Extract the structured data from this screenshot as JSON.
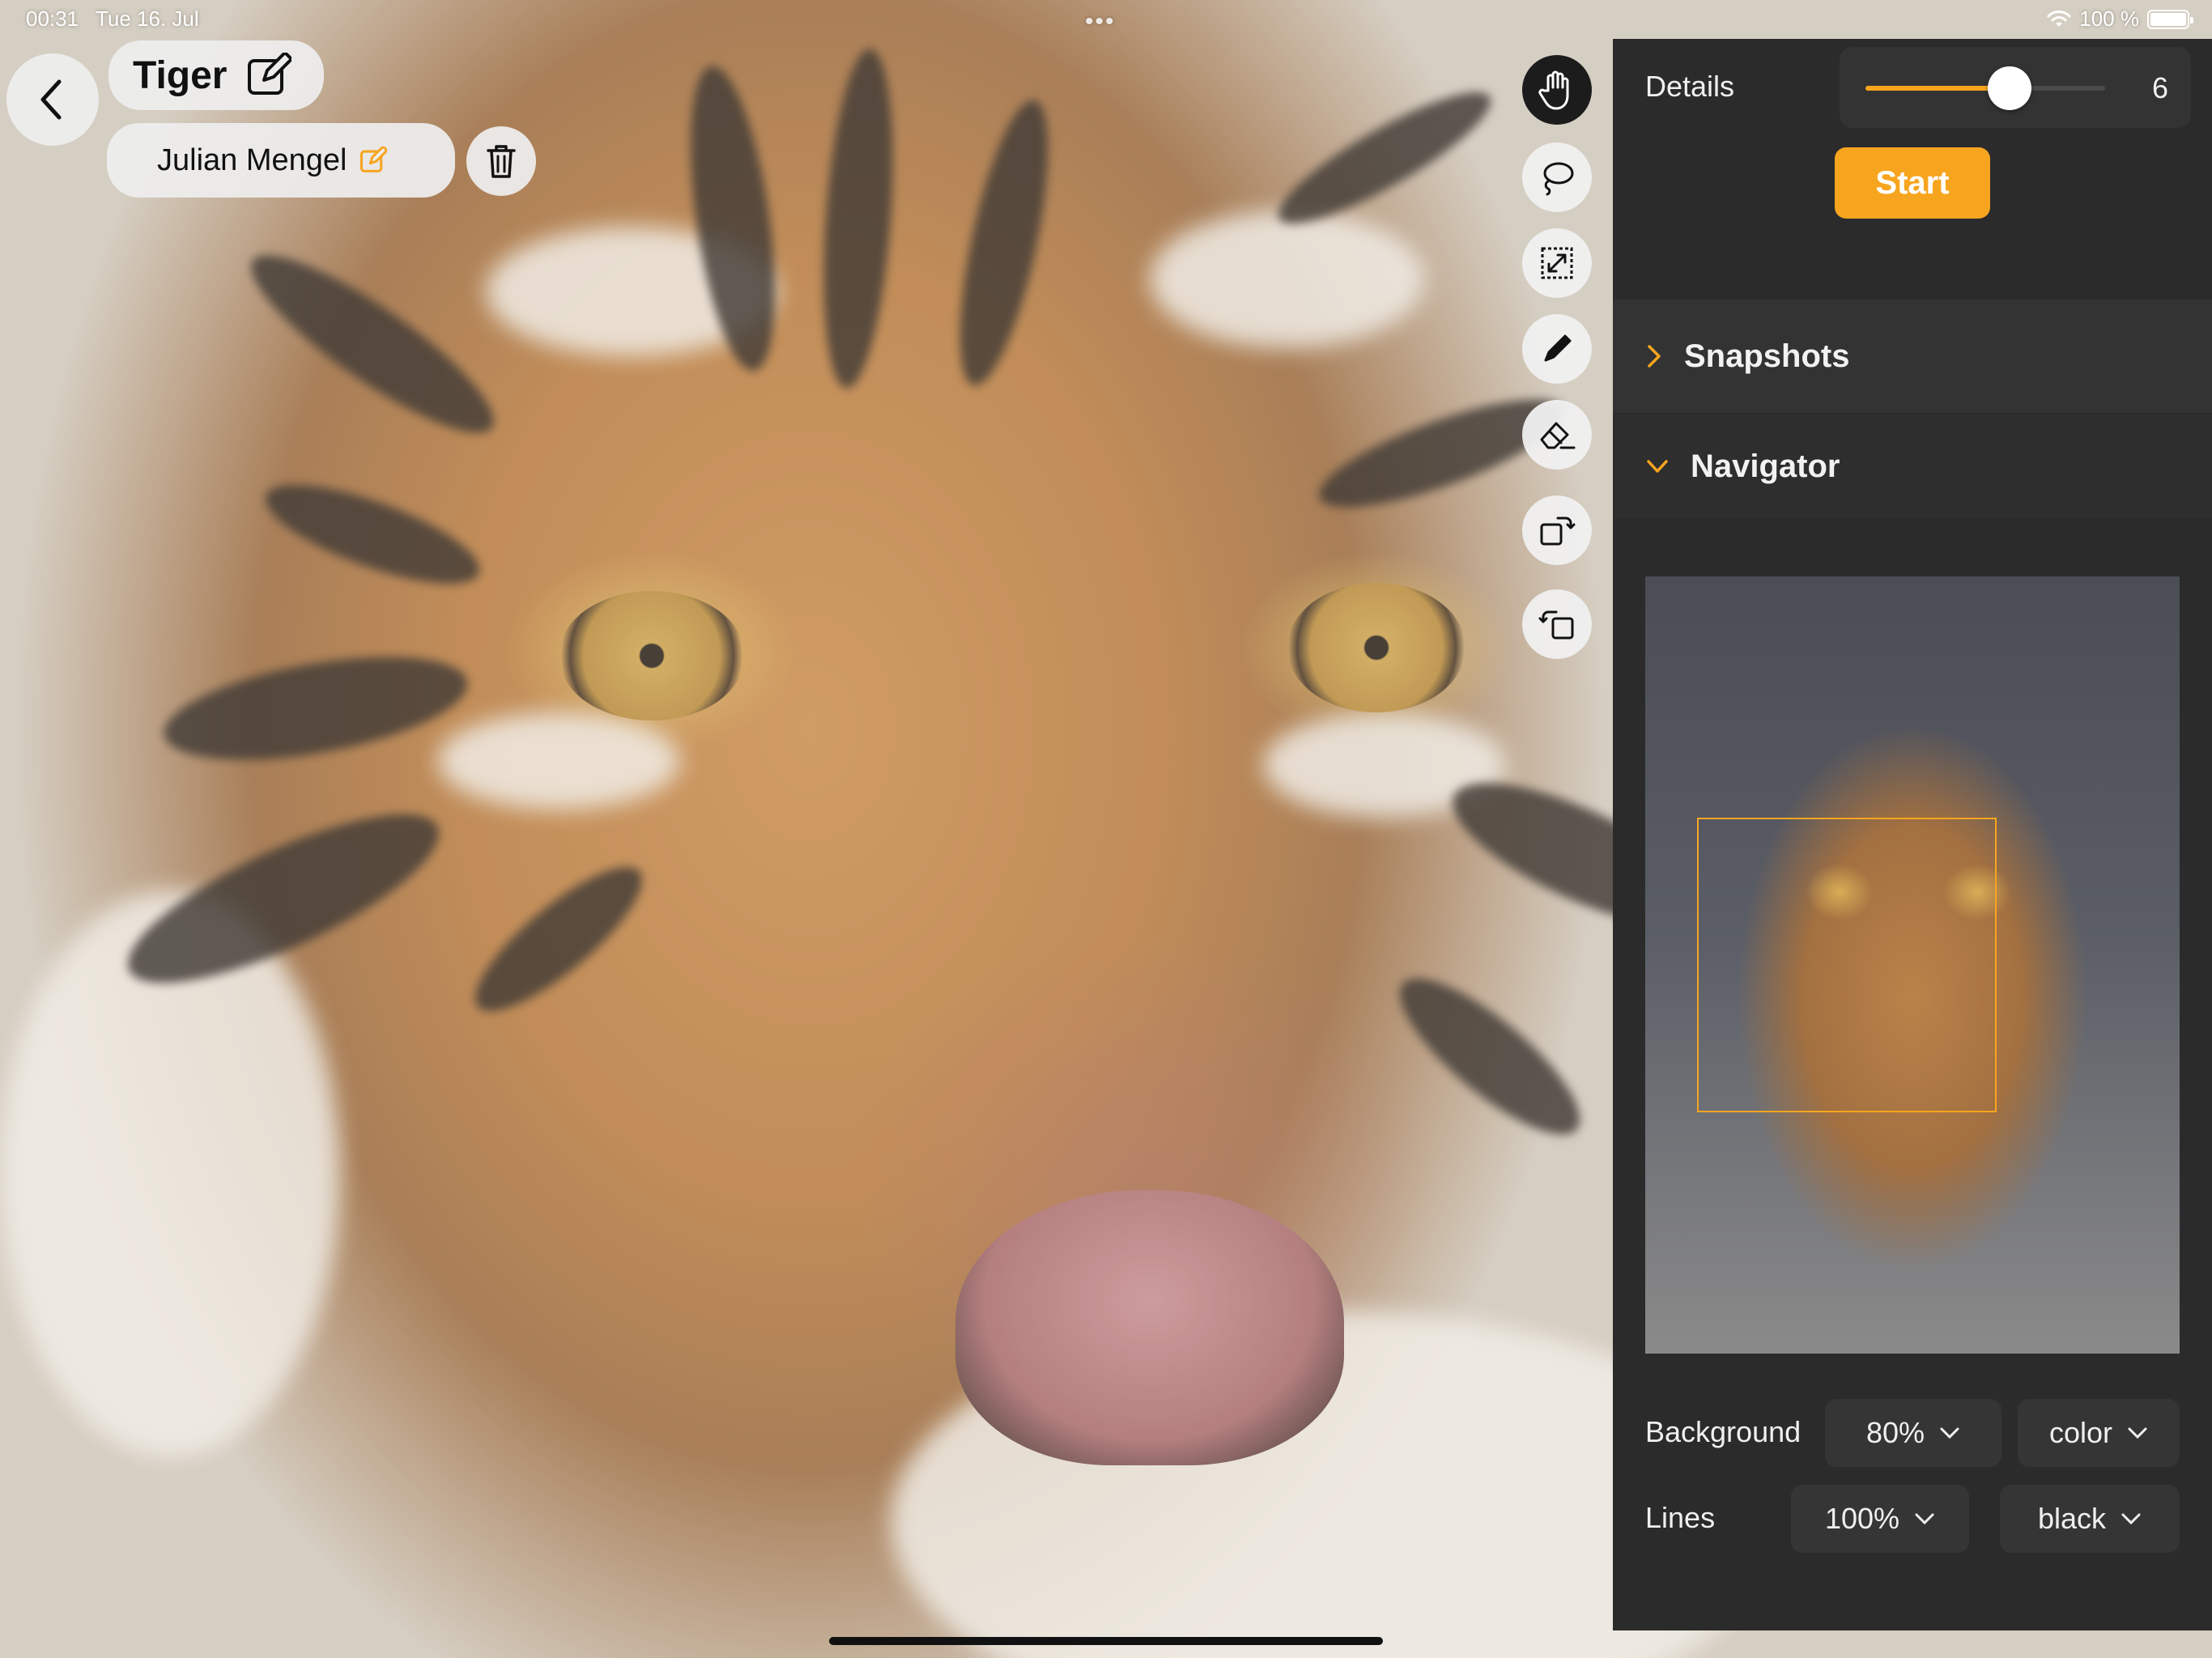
{
  "status_bar": {
    "time": "00:31",
    "date": "Tue 16. Jul",
    "battery": "100 %",
    "multitask_dots": "•••"
  },
  "drawing": {
    "title": "Tiger",
    "author": "Julian Mengel"
  },
  "toolbar": {
    "tools": [
      {
        "name": "hand",
        "active": true
      },
      {
        "name": "lasso",
        "active": false
      },
      {
        "name": "resize",
        "active": false
      },
      {
        "name": "pencil",
        "active": false
      },
      {
        "name": "eraser",
        "active": false
      },
      {
        "name": "rotate-right",
        "active": false
      },
      {
        "name": "rotate-left",
        "active": false
      }
    ]
  },
  "panel": {
    "details_label": "Details",
    "details_value": "6",
    "details_slider_fraction": 0.6,
    "start_label": "Start",
    "snapshots_label": "Snapshots",
    "snapshots_expanded": false,
    "navigator_label": "Navigator",
    "navigator_expanded": true,
    "background_label": "Background",
    "background_opacity": "80%",
    "background_mode": "color",
    "lines_label": "Lines",
    "lines_opacity": "100%",
    "lines_color": "black"
  },
  "colors": {
    "accent": "#f7a51f",
    "panel_bg": "#2b2b2b",
    "pill_bg": "#eeeeee"
  }
}
